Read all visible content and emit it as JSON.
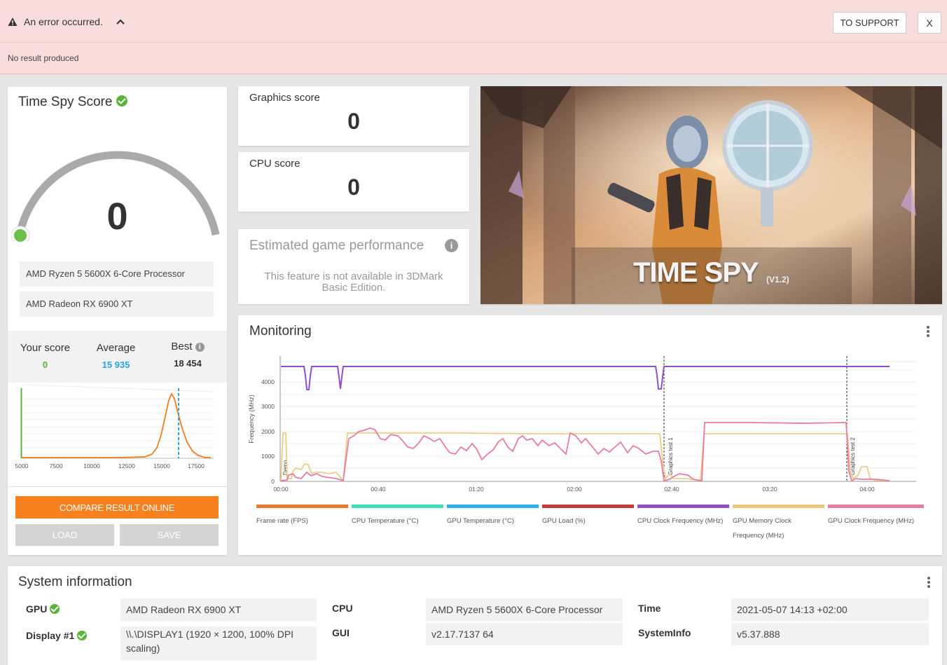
{
  "banner": {
    "title": "An error occurred.",
    "subtitle": "No result produced",
    "support_label": "TO SUPPORT",
    "close_label": "X",
    "icons": [
      "warning-icon",
      "chevron-up-icon"
    ]
  },
  "score": {
    "title": "Time Spy Score",
    "value": "0",
    "cpu": "AMD Ryzen 5 5600X 6-Core Processor",
    "gpu": "AMD Radeon RX 6900 XT",
    "your_label": "Your score",
    "your_value": "0",
    "avg_label": "Average",
    "avg_value": "15 935",
    "best_label": "Best",
    "best_value": "18 454",
    "compare_label": "COMPARE RESULT ONLINE",
    "load_label": "LOAD",
    "save_label": "SAVE",
    "dist_ticks": [
      "5000",
      "7500",
      "10000",
      "12500",
      "15000",
      "17500"
    ]
  },
  "graphics": {
    "label": "Graphics score",
    "value": "0"
  },
  "cpu_score": {
    "label": "CPU score",
    "value": "0"
  },
  "egp": {
    "title": "Estimated game performance",
    "text": "This feature is not available in 3DMark Basic Edition."
  },
  "hero": {
    "brand": "TIME SPY",
    "version": "(V1.2)"
  },
  "monitoring": {
    "title": "Monitoring",
    "ylabel": "Frequency (MHz)",
    "yticks": [
      "0",
      "1000",
      "2000",
      "3000",
      "4000"
    ],
    "xticks": [
      "00:00",
      "00:40",
      "01:20",
      "02:00",
      "02:40",
      "03:20",
      "04:00"
    ],
    "markers": [
      "Demo",
      "Graphics test 1",
      "Graphics test 2"
    ],
    "legend": [
      {
        "label": "Frame rate (FPS)",
        "color": "#e87c2a"
      },
      {
        "label": "CPU Temperature (°C)",
        "color": "#3de0b8"
      },
      {
        "label": "GPU Temperature (°C)",
        "color": "#29b3e8"
      },
      {
        "label": "GPU Load (%)",
        "color": "#c83a3a"
      },
      {
        "label": "CPU Clock Frequency (MHz)",
        "color": "#9150c8"
      },
      {
        "label": "GPU Memory Clock Frequency (MHz)",
        "color": "#e8c97a"
      },
      {
        "label": "GPU Clock Frequency (MHz)",
        "color": "#e87ba6"
      }
    ]
  },
  "sysinfo": {
    "title": "System information",
    "gpu_label": "GPU",
    "gpu_value": "AMD Radeon RX 6900 XT",
    "display_label": "Display #1",
    "display_value": "\\\\.\\DISPLAY1 (1920 × 1200, 100% DPI scaling)",
    "cpu_label": "CPU",
    "cpu_value": "AMD Ryzen 5 5600X 6-Core Processor",
    "gui_label": "GUI",
    "gui_value": "v2.17.7137 64",
    "time_label": "Time",
    "time_value": "2021-05-07 14:13 +02:00",
    "sysinfo_label": "SystemInfo",
    "sysinfo_value": "v5.37.888"
  },
  "colors": {
    "accent": "#f7801f",
    "ok": "#58b53a",
    "average": "#29a3e0",
    "banner": "#f9dcdc"
  }
}
